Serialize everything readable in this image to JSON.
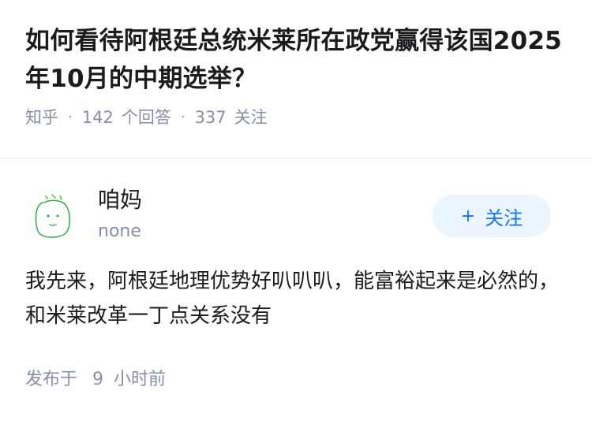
{
  "question": {
    "title": "如何看待阿根廷总统米莱所在政党赢得该国2025年10月的中期选举？",
    "source": "知乎",
    "answers_count": "142",
    "answers_label": "个回答",
    "followers_count": "337",
    "followers_label": "关注"
  },
  "answer": {
    "author_name": "咱妈",
    "author_bio": "none",
    "follow_label": "关注",
    "follow_icon": "plus-icon",
    "content": "我先来，阿根廷地理优势好叭叭叭，能富裕起来是必然的，和米莱改革一丁点关系没有",
    "time_prefix": "发布于",
    "time_value": "9",
    "time_unit": "小时前"
  },
  "colors": {
    "title": "#191b1f",
    "meta": "#8590a6",
    "accent": "#1772f6",
    "follow_bg": "#ebf5fd",
    "avatar_stroke": "#3fb14a"
  }
}
